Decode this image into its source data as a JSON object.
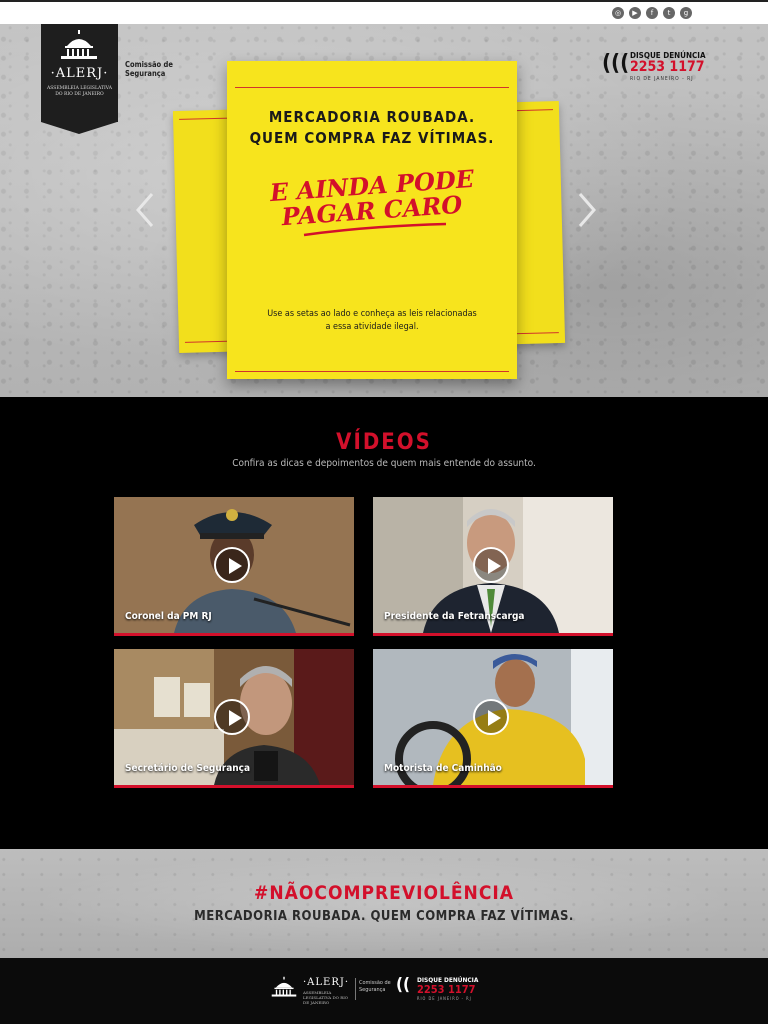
{
  "header": {
    "social_icons": [
      "instagram-icon",
      "youtube-icon",
      "facebook-icon",
      "twitter-icon",
      "google-plus-icon"
    ],
    "social_glyphs": [
      "◎",
      "▶",
      "f",
      "t",
      "g"
    ],
    "logo": {
      "name": "·ALERJ·",
      "subtitle_line1": "ASSEMBLEIA LEGISLATIVA",
      "subtitle_line2": "DO RIO DE JANEIRO"
    },
    "commission": {
      "line1": "Comissão de",
      "line2": "Segurança"
    },
    "hotline": {
      "title": "DISQUE DENÚNCIA",
      "number": "2253 1177",
      "region": "RIO DE JANEIRO - RJ"
    }
  },
  "hero": {
    "headline_line1": "MERCADORIA ROUBADA.",
    "headline_line2": "QUEM COMPRA FAZ VÍTIMAS.",
    "script_line1": "E AINDA PODE",
    "script_line2": "PAGAR CARO",
    "instructions_line1": "Use as setas ao lado e conheça as leis relacionadas",
    "instructions_line2": "a essa atividade ilegal."
  },
  "videos": {
    "title": "VÍDEOS",
    "subtitle": "Confira as dicas e depoimentos de quem mais entende do assunto.",
    "items": [
      {
        "caption": "Coronel da PM RJ"
      },
      {
        "caption": "Presidente da Fetranscarga"
      },
      {
        "caption": "Secretário de Segurança"
      },
      {
        "caption": "Motorista de Caminhão"
      }
    ]
  },
  "campaign": {
    "hashtag": "#NÃOCOMPREVIOLÊNCIA",
    "tagline": "MERCADORIA ROUBADA. QUEM COMPRA FAZ VÍTIMAS."
  },
  "footer": {
    "logo_name": "·ALERJ·",
    "logo_sub": "ASSEMBLEIA LEGISLATIVA DO RIO DE JANEIRO",
    "commission_line1": "Comissão de",
    "commission_line2": "Segurança",
    "hotline_title": "DISQUE DENÚNCIA",
    "hotline_number": "2253 1177",
    "hotline_region": "RIO DE JANEIRO - RJ"
  },
  "colors": {
    "accent": "#d3102b",
    "paper": "#f7e41d",
    "dark": "#000000"
  }
}
